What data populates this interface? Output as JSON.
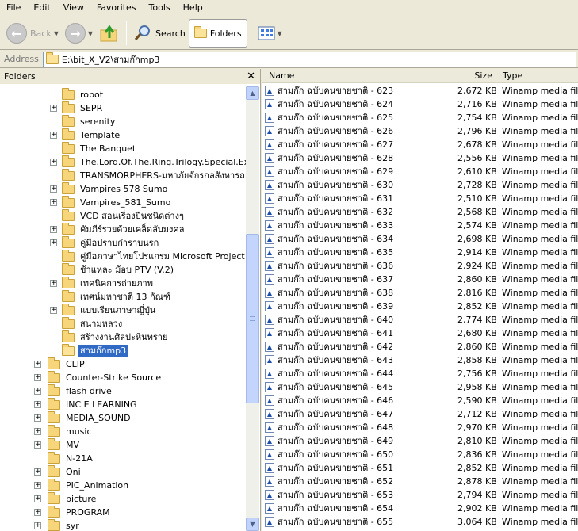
{
  "menu": [
    "File",
    "Edit",
    "View",
    "Favorites",
    "Tools",
    "Help"
  ],
  "toolbar": {
    "back_label": "Back",
    "search_label": "Search",
    "folders_label": "Folders"
  },
  "address": {
    "label": "Address",
    "path": "E:\\bit_X_V2\\สามก๊กmp3"
  },
  "folders_pane": {
    "title": "Folders",
    "items": [
      {
        "label": "robot",
        "expandable": false,
        "level": 2
      },
      {
        "label": "SEPR",
        "expandable": true,
        "level": 2
      },
      {
        "label": "serenity",
        "expandable": false,
        "level": 2
      },
      {
        "label": "Template",
        "expandable": true,
        "level": 2
      },
      {
        "label": "The Banquet",
        "expandable": false,
        "level": 2
      },
      {
        "label": "The.Lord.Of.The.Ring.Trilogy.Special.Exter",
        "expandable": true,
        "level": 2
      },
      {
        "label": "TRANSMORPHERS-มหาภัยจักรกลสังหารถล่มโ",
        "expandable": false,
        "level": 2
      },
      {
        "label": "Vampires 578 Sumo",
        "expandable": true,
        "level": 2
      },
      {
        "label": "Vampires_581_Sumo",
        "expandable": true,
        "level": 2
      },
      {
        "label": "VCD สอนเรื่องปืนชนิดต่างๆ",
        "expandable": false,
        "level": 2
      },
      {
        "label": "คัมภีร์รวยด้วยเคล็ดลับมงคล",
        "expandable": true,
        "level": 2
      },
      {
        "label": "คู่มือปราบกำราบนรก",
        "expandable": true,
        "level": 2
      },
      {
        "label": "คู่มือภาษาไทยโปรแกรม Microsoft Project 20",
        "expandable": false,
        "level": 2
      },
      {
        "label": "ช้าแหละ ม้อบ PTV (V.2)",
        "expandable": false,
        "level": 2
      },
      {
        "label": "เทคนิคการถ่ายภาพ",
        "expandable": true,
        "level": 2
      },
      {
        "label": "เทศน์มหาชาติ 13 กัณฑ์",
        "expandable": false,
        "level": 2
      },
      {
        "label": "แบบเรียนภาษาญี่ปุ่น",
        "expandable": true,
        "level": 2
      },
      {
        "label": "สนามหลวง",
        "expandable": false,
        "level": 2
      },
      {
        "label": "สร้างงานศิลปะหินทราย",
        "expandable": false,
        "level": 2
      },
      {
        "label": "สามก๊กmp3",
        "expandable": false,
        "level": 2,
        "selected": true
      },
      {
        "label": "CLIP",
        "expandable": true,
        "level": 1
      },
      {
        "label": "Counter-Strike Source",
        "expandable": true,
        "level": 1
      },
      {
        "label": "flash drive",
        "expandable": true,
        "level": 1
      },
      {
        "label": "INC E LEARNING",
        "expandable": true,
        "level": 1
      },
      {
        "label": "MEDIA_SOUND",
        "expandable": true,
        "level": 1
      },
      {
        "label": "music",
        "expandable": true,
        "level": 1
      },
      {
        "label": "MV",
        "expandable": true,
        "level": 1
      },
      {
        "label": "N-21A",
        "expandable": false,
        "level": 1
      },
      {
        "label": "Oni",
        "expandable": true,
        "level": 1
      },
      {
        "label": "PIC_Animation",
        "expandable": true,
        "level": 1
      },
      {
        "label": "picture",
        "expandable": true,
        "level": 1
      },
      {
        "label": "PROGRAM",
        "expandable": true,
        "level": 1
      },
      {
        "label": "syr",
        "expandable": true,
        "level": 1
      }
    ]
  },
  "file_list": {
    "columns": {
      "name": "Name",
      "size": "Size",
      "type": "Type"
    },
    "rows": [
      {
        "name": "สามก๊ก ฉบับคนขายชาติ - 623",
        "size": "2,672 KB",
        "type": "Winamp media file"
      },
      {
        "name": "สามก๊ก ฉบับคนขายชาติ - 624",
        "size": "2,716 KB",
        "type": "Winamp media file"
      },
      {
        "name": "สามก๊ก ฉบับคนขายชาติ - 625",
        "size": "2,754 KB",
        "type": "Winamp media file"
      },
      {
        "name": "สามก๊ก ฉบับคนขายชาติ - 626",
        "size": "2,796 KB",
        "type": "Winamp media file"
      },
      {
        "name": "สามก๊ก ฉบับคนขายชาติ - 627",
        "size": "2,678 KB",
        "type": "Winamp media file"
      },
      {
        "name": "สามก๊ก ฉบับคนขายชาติ - 628",
        "size": "2,556 KB",
        "type": "Winamp media file"
      },
      {
        "name": "สามก๊ก ฉบับคนขายชาติ - 629",
        "size": "2,610 KB",
        "type": "Winamp media file"
      },
      {
        "name": "สามก๊ก ฉบับคนขายชาติ - 630",
        "size": "2,728 KB",
        "type": "Winamp media file"
      },
      {
        "name": "สามก๊ก ฉบับคนขายชาติ - 631",
        "size": "2,510 KB",
        "type": "Winamp media file"
      },
      {
        "name": "สามก๊ก ฉบับคนขายชาติ - 632",
        "size": "2,568 KB",
        "type": "Winamp media file"
      },
      {
        "name": "สามก๊ก ฉบับคนขายชาติ - 633",
        "size": "2,574 KB",
        "type": "Winamp media file"
      },
      {
        "name": "สามก๊ก ฉบับคนขายชาติ - 634",
        "size": "2,698 KB",
        "type": "Winamp media file"
      },
      {
        "name": "สามก๊ก ฉบับคนขายชาติ - 635",
        "size": "2,914 KB",
        "type": "Winamp media file"
      },
      {
        "name": "สามก๊ก ฉบับคนขายชาติ - 636",
        "size": "2,924 KB",
        "type": "Winamp media file"
      },
      {
        "name": "สามก๊ก ฉบับคนขายชาติ - 637",
        "size": "2,860 KB",
        "type": "Winamp media file"
      },
      {
        "name": "สามก๊ก ฉบับคนขายชาติ - 638",
        "size": "2,816 KB",
        "type": "Winamp media file"
      },
      {
        "name": "สามก๊ก ฉบับคนขายชาติ - 639",
        "size": "2,852 KB",
        "type": "Winamp media file"
      },
      {
        "name": "สามก๊ก ฉบับคนขายชาติ - 640",
        "size": "2,774 KB",
        "type": "Winamp media file"
      },
      {
        "name": "สามก๊ก ฉบับคนขายชาติ - 641",
        "size": "2,680 KB",
        "type": "Winamp media file"
      },
      {
        "name": "สามก๊ก ฉบับคนขายชาติ - 642",
        "size": "2,860 KB",
        "type": "Winamp media file"
      },
      {
        "name": "สามก๊ก ฉบับคนขายชาติ - 643",
        "size": "2,858 KB",
        "type": "Winamp media file"
      },
      {
        "name": "สามก๊ก ฉบับคนขายชาติ - 644",
        "size": "2,756 KB",
        "type": "Winamp media file"
      },
      {
        "name": "สามก๊ก ฉบับคนขายชาติ - 645",
        "size": "2,958 KB",
        "type": "Winamp media file"
      },
      {
        "name": "สามก๊ก ฉบับคนขายชาติ - 646",
        "size": "2,590 KB",
        "type": "Winamp media file"
      },
      {
        "name": "สามก๊ก ฉบับคนขายชาติ - 647",
        "size": "2,712 KB",
        "type": "Winamp media file"
      },
      {
        "name": "สามก๊ก ฉบับคนขายชาติ - 648",
        "size": "2,970 KB",
        "type": "Winamp media file"
      },
      {
        "name": "สามก๊ก ฉบับคนขายชาติ - 649",
        "size": "2,810 KB",
        "type": "Winamp media file"
      },
      {
        "name": "สามก๊ก ฉบับคนขายชาติ - 650",
        "size": "2,836 KB",
        "type": "Winamp media file"
      },
      {
        "name": "สามก๊ก ฉบับคนขายชาติ - 651",
        "size": "2,852 KB",
        "type": "Winamp media file"
      },
      {
        "name": "สามก๊ก ฉบับคนขายชาติ - 652",
        "size": "2,878 KB",
        "type": "Winamp media file"
      },
      {
        "name": "สามก๊ก ฉบับคนขายชาติ - 653",
        "size": "2,794 KB",
        "type": "Winamp media file"
      },
      {
        "name": "สามก๊ก ฉบับคนขายชาติ - 654",
        "size": "2,902 KB",
        "type": "Winamp media file"
      },
      {
        "name": "สามก๊ก ฉบับคนขายชาติ - 655",
        "size": "3,064 KB",
        "type": "Winamp media file"
      }
    ]
  },
  "icons": [
    "back-icon",
    "forward-icon",
    "up-folder-icon",
    "search-icon",
    "folders-icon",
    "views-icon",
    "folder-icon",
    "winamp-file-icon",
    "close-icon"
  ],
  "colors": {
    "selection": "#316ac5",
    "window_bg": "#ece9d8"
  }
}
